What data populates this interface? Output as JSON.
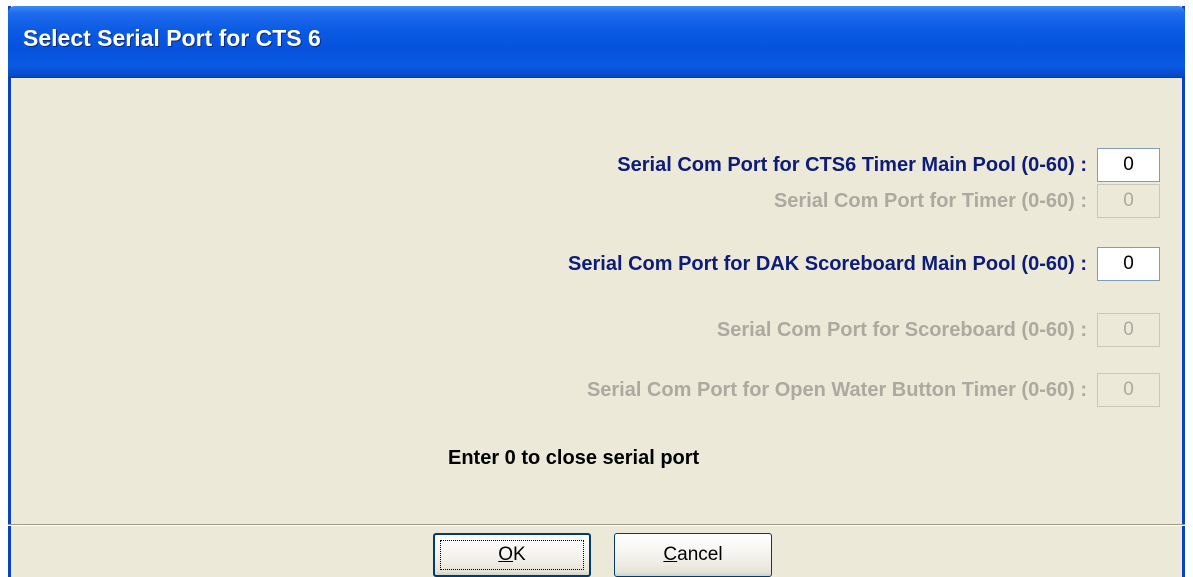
{
  "window": {
    "title": "Select Serial Port for CTS 6"
  },
  "ports": [
    {
      "label": "Serial Com Port for CTS6 Timer Main Pool (0-60) :",
      "value": "0",
      "enabled": true
    },
    {
      "label": "Serial Com Port for Timer (0-60) :",
      "value": "0",
      "enabled": false
    },
    {
      "label": "Serial Com Port for DAK Scoreboard Main Pool (0-60) :",
      "value": "0",
      "enabled": true
    },
    {
      "label": "Serial Com Port for Scoreboard (0-60) :",
      "value": "0",
      "enabled": false
    },
    {
      "label": "Serial Com Port for Open Water Button Timer (0-60) :",
      "value": "0",
      "enabled": false
    }
  ],
  "hint": "Enter 0 to close serial port",
  "buttons": {
    "ok": {
      "mnemonic": "O",
      "rest": "K"
    },
    "cancel": {
      "mnemonic": "C",
      "rest": "ancel"
    }
  },
  "colors": {
    "enabled_label": "#0c1c78",
    "disabled_label": "#acaaa0",
    "titlebar": "#0652dd",
    "dialog_background": "#ece9d8"
  }
}
